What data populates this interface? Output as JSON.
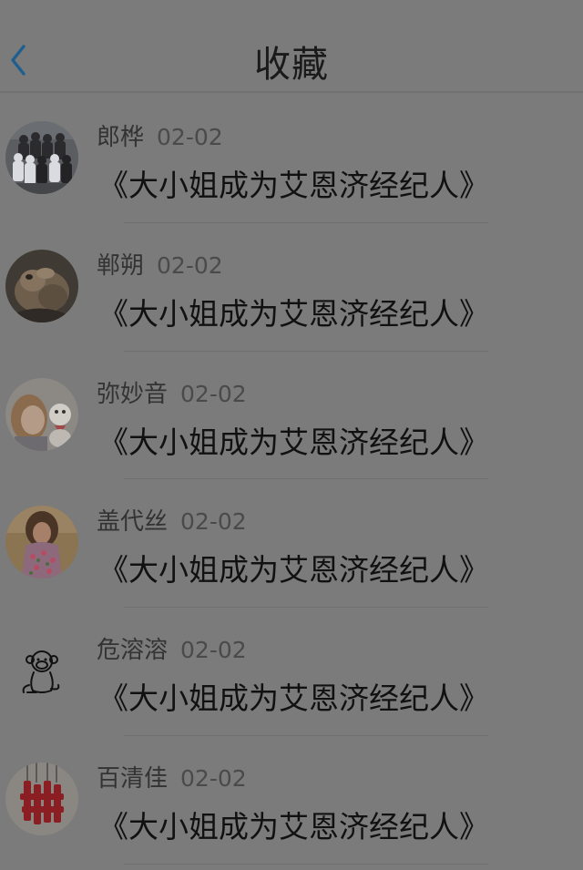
{
  "header": {
    "title": "收藏",
    "back_icon": "chevron-left-icon",
    "accent_color": "#1f5f8f"
  },
  "items": [
    {
      "name": "郎桦",
      "date": "02-02",
      "title": "《大小姐成为艾恩济经纪人》",
      "avatar": "group-photo-avatar"
    },
    {
      "name": "郸朔",
      "date": "02-02",
      "title": "《大小姐成为艾恩济经纪人》",
      "avatar": "animal-photo-avatar"
    },
    {
      "name": "弥妙音",
      "date": "02-02",
      "title": "《大小姐成为艾恩济经纪人》",
      "avatar": "girl-with-toy-avatar"
    },
    {
      "name": "盖代丝",
      "date": "02-02",
      "title": "《大小姐成为艾恩济经纪人》",
      "avatar": "girl-floral-dress-avatar"
    },
    {
      "name": "危溶溶",
      "date": "02-02",
      "title": "《大小姐成为艾恩济经纪人》",
      "avatar": "monkey-sketch-avatar"
    },
    {
      "name": "百清佳",
      "date": "02-02",
      "title": "《大小姐成为艾恩济经纪人》",
      "avatar": "red-knot-ornament-avatar"
    }
  ]
}
